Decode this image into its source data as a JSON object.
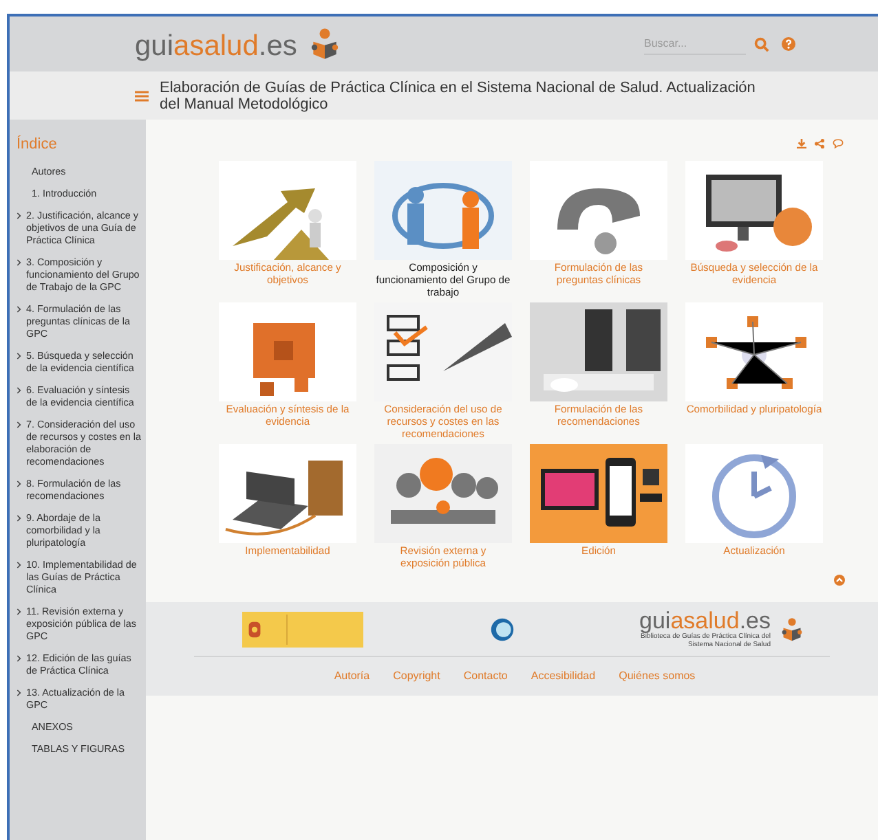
{
  "header": {
    "logo": {
      "prefix": "gui",
      "brand": "asalud",
      "suffix": ".es"
    },
    "search": {
      "placeholder": "Buscar..."
    }
  },
  "title": "Elaboración de Guías de Práctica Clínica en el Sistema Nacional de Salud. Actualización del Manual Metodológico",
  "sidebar": {
    "heading": "Índice",
    "items": [
      {
        "label": "Autores",
        "expandable": false
      },
      {
        "label": "1. Introducción",
        "expandable": false
      },
      {
        "label": "2. Justificación, alcance y objetivos de una Guía de Práctica Clínica",
        "expandable": true
      },
      {
        "label": "3. Composición y funcionamiento del Grupo de Trabajo de la GPC",
        "expandable": true
      },
      {
        "label": "4. Formulación de las preguntas clínicas de la GPC",
        "expandable": true
      },
      {
        "label": "5. Búsqueda y selección de la evidencia científica",
        "expandable": true
      },
      {
        "label": "6. Evaluación y síntesis de la evidencia científica",
        "expandable": true
      },
      {
        "label": "7. Consideración del uso de recursos y costes en la elaboración de recomendaciones",
        "expandable": true
      },
      {
        "label": "8. Formulación de las recomendaciones",
        "expandable": true
      },
      {
        "label": "9. Abordaje de la comorbilidad y la pluripatología",
        "expandable": true
      },
      {
        "label": "10. Implementabilidad de las Guías de Práctica Clínica",
        "expandable": true
      },
      {
        "label": "11. Revisión externa y exposición pública de las GPC",
        "expandable": true
      },
      {
        "label": "12. Edición de las guías de Práctica Clínica",
        "expandable": true
      },
      {
        "label": "13. Actualización de la GPC",
        "expandable": true
      },
      {
        "label": "ANEXOS",
        "expandable": false
      },
      {
        "label": "TABLAS Y FIGURAS",
        "expandable": false
      }
    ]
  },
  "tiles": [
    {
      "caption": "Justificación, alcance y objetivos",
      "selected": false
    },
    {
      "caption": "Composición y funcionamiento del Grupo de trabajo",
      "selected": true
    },
    {
      "caption": "Formulación de las preguntas clínicas",
      "selected": false
    },
    {
      "caption": "Búsqueda y selección de la evidencia",
      "selected": false
    },
    {
      "caption": "Evaluación y síntesis de la evidencia",
      "selected": false
    },
    {
      "caption": "Consideración del uso de recursos y costes en las recomendaciones",
      "selected": false
    },
    {
      "caption": "Formulación de las recomendaciones",
      "selected": false
    },
    {
      "caption": "Comorbilidad y pluripatología",
      "selected": false
    },
    {
      "caption": "Implementabilidad",
      "selected": false
    },
    {
      "caption": "Revisión externa y exposición pública",
      "selected": false
    },
    {
      "caption": "Edición",
      "selected": false
    },
    {
      "caption": "Actualización",
      "selected": false
    }
  ],
  "footer": {
    "logo": {
      "prefix": "gui",
      "brand": "asalud",
      "suffix": ".es",
      "subtitle": "Biblioteca de Guías de Práctica Clínica del Sistema Nacional de Salud"
    },
    "links": [
      "Autoría",
      "Copyright",
      "Contacto",
      "Accesibilidad",
      "Quiénes somos"
    ]
  }
}
